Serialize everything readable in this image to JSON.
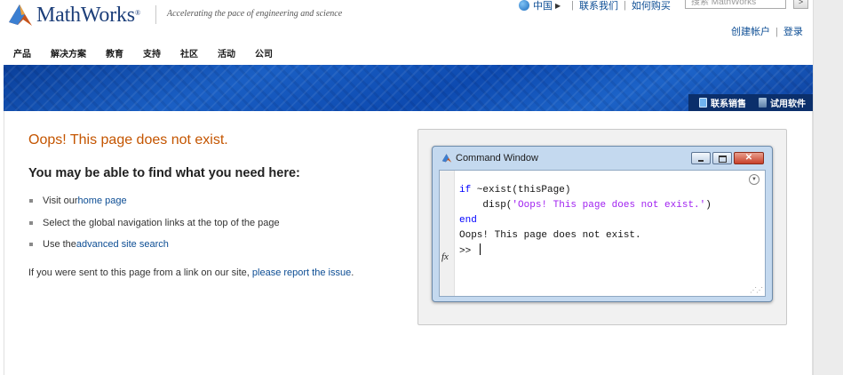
{
  "header": {
    "brand": "MathWorks",
    "trademark": "®",
    "tagline": "Accelerating the pace of engineering and science",
    "util_links": [
      "中国",
      "联系我们",
      "如何购买"
    ],
    "search_placeholder": "搜索 MathWorks",
    "search_button": ">",
    "account_links": [
      "创建帐户",
      "登录"
    ]
  },
  "nav": [
    "产品",
    "解决方案",
    "教育",
    "支持",
    "社区",
    "活动",
    "公司"
  ],
  "banner": {
    "contact_sales": "联系销售",
    "trial": "试用软件"
  },
  "main": {
    "error_title": "Oops! This page does not exist.",
    "subheading": "You may be able to find what you need here:",
    "suggestions": [
      {
        "prefix": "Visit our ",
        "link": "home page"
      },
      {
        "prefix": "Select the global navigation links at the top of the page",
        "link": ""
      },
      {
        "prefix": "Use the ",
        "link": "advanced site search"
      }
    ],
    "report_prefix": "If you were sent to this page from a link on our site, ",
    "report_link": "please report the issue",
    "report_suffix": "."
  },
  "command_window": {
    "title": "Command Window",
    "code": {
      "l1_kw": "if",
      "l1_rest": " ~exist(thisPage)",
      "l2_pre": "    disp(",
      "l2_str": "'Oops! This page does not exist.'",
      "l2_post": ")",
      "l3_kw": "end",
      "l4": "Oops! This page does not exist.",
      "l5": ">> "
    },
    "fx_label": "fx"
  },
  "colors": {
    "error_title": "#c45500",
    "link": "#0c4d94",
    "banner": "#1a5fc4",
    "keyword": "#0000ff",
    "string": "#a020f0"
  }
}
